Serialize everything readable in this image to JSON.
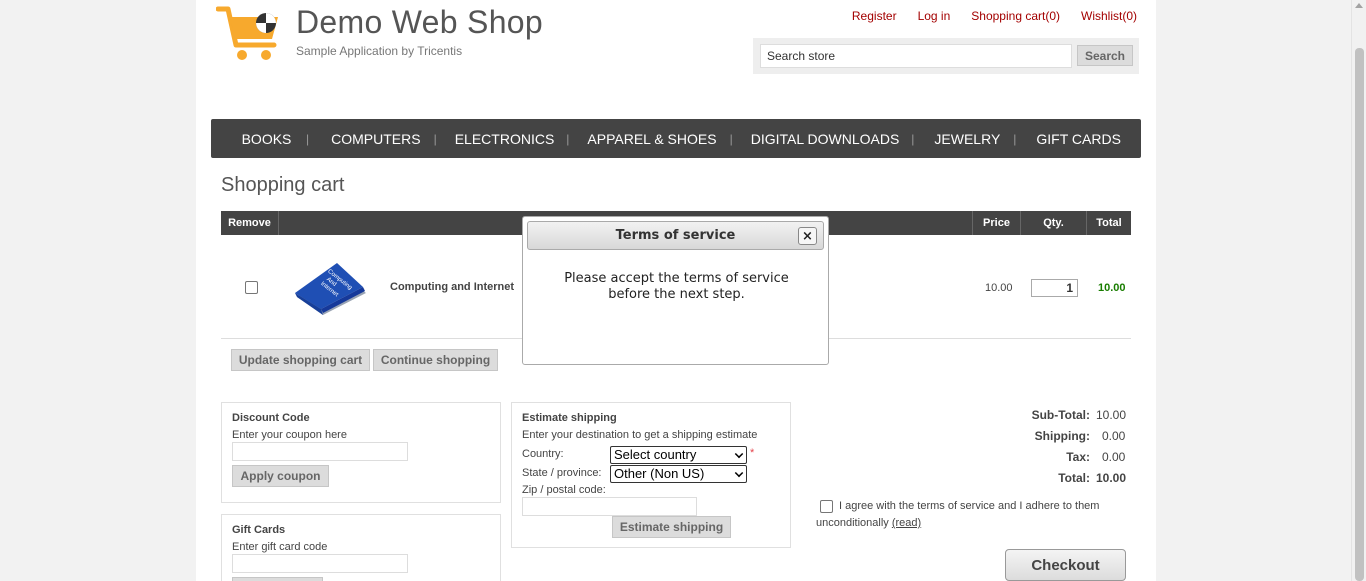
{
  "header": {
    "title": "Demo Web Shop",
    "subtitle": "Sample Application by Tricentis",
    "links": {
      "register": "Register",
      "login": "Log in",
      "cart": "Shopping cart(0)",
      "wishlist": "Wishlist(0)"
    },
    "search": {
      "value": "Search store",
      "button": "Search"
    }
  },
  "menu": [
    "BOOKS",
    "COMPUTERS",
    "ELECTRONICS",
    "APPAREL & SHOES",
    "DIGITAL DOWNLOADS",
    "JEWELRY",
    "GIFT CARDS"
  ],
  "cart": {
    "title": "Shopping cart",
    "columns": {
      "remove": "Remove",
      "price": "Price",
      "qty": "Qty.",
      "total": "Total"
    },
    "items": [
      {
        "image_text": "Computing And Internet",
        "name": "Computing and Internet",
        "price": "10.00",
        "qty": "1",
        "total": "10.00"
      }
    ],
    "update_button": "Update shopping cart",
    "continue_button": "Continue shopping"
  },
  "discount": {
    "title": "Discount Code",
    "hint": "Enter your coupon here",
    "button": "Apply coupon"
  },
  "giftcards": {
    "title": "Gift Cards",
    "hint": "Enter gift card code"
  },
  "shipping": {
    "title": "Estimate shipping",
    "hint": "Enter your destination to get a shipping estimate",
    "country_label": "Country:",
    "country_value": "Select country",
    "required_mark": "*",
    "state_label": "State / province:",
    "state_value": "Other (Non US)",
    "zip_label": "Zip / postal code:",
    "button": "Estimate shipping"
  },
  "totals": {
    "subtotal_label": "Sub-Total:",
    "subtotal": "10.00",
    "shipping_label": "Shipping:",
    "shipping": "0.00",
    "tax_label": "Tax:",
    "tax": "0.00",
    "total_label": "Total:",
    "total": "10.00"
  },
  "terms": {
    "text": "I agree with the terms of service and I adhere to them unconditionally",
    "read": "(read)"
  },
  "checkout": "Checkout",
  "modal": {
    "title": "Terms of service",
    "close": "×",
    "message": "Please accept the terms of service before the next step."
  },
  "colors": {
    "link": "#a30000",
    "menu_bg": "#444444",
    "total_green": "#197d00",
    "logo_orange": "#f7a92d"
  }
}
